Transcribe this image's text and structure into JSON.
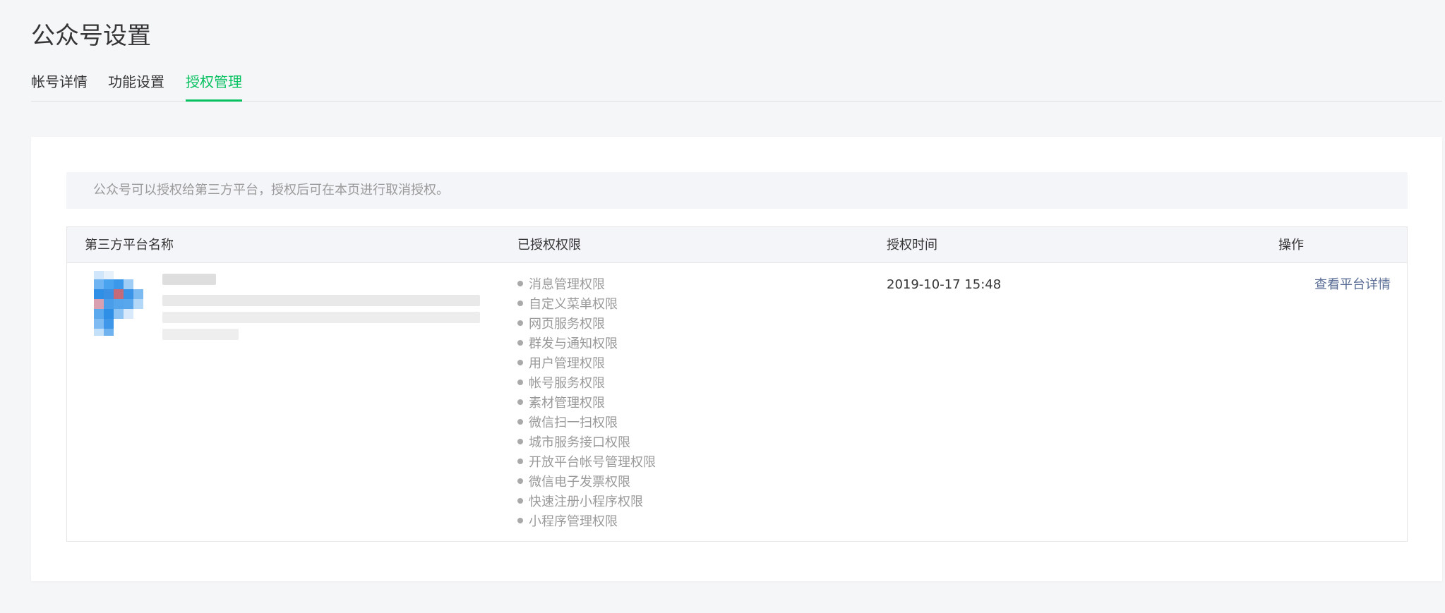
{
  "page": {
    "title": "公众号设置"
  },
  "tabs": [
    {
      "label": "帐号详情"
    },
    {
      "label": "功能设置"
    },
    {
      "label": "授权管理"
    }
  ],
  "notice": "公众号可以授权给第三方平台，授权后可在本页进行取消授权。",
  "table": {
    "headers": {
      "platform": "第三方平台名称",
      "permissions": "已授权权限",
      "time": "授权时间",
      "action": "操作"
    },
    "row": {
      "permissions": [
        "消息管理权限",
        "自定义菜单权限",
        "网页服务权限",
        "群发与通知权限",
        "用户管理权限",
        "帐号服务权限",
        "素材管理权限",
        "微信扫一扫权限",
        "城市服务接口权限",
        "开放平台帐号管理权限",
        "微信电子发票权限",
        "快速注册小程序权限",
        "小程序管理权限"
      ],
      "time": "2019-10-17 15:48",
      "action": "查看平台详情"
    }
  },
  "colors": {
    "accent": "#07c160",
    "link": "#576b95",
    "muted": "#9a9a9a"
  },
  "icons": {
    "platform_logo": "pixelated-platform-logo-icon"
  }
}
